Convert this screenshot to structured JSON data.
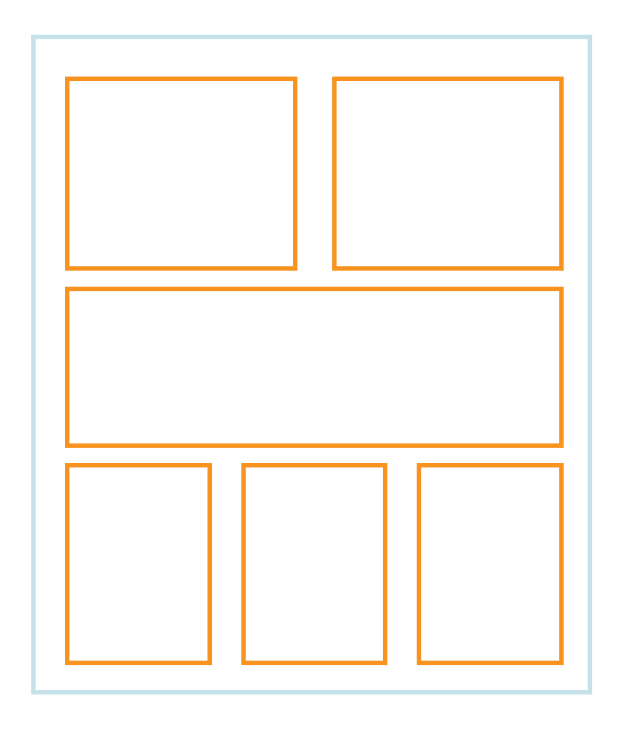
{
  "colors": {
    "frame_border": "#c5e1e9",
    "panel_border": "#f7931e",
    "background": "#ffffff"
  },
  "layout": {
    "rows": [
      {
        "panels": 2
      },
      {
        "panels": 1
      },
      {
        "panels": 3
      }
    ]
  }
}
